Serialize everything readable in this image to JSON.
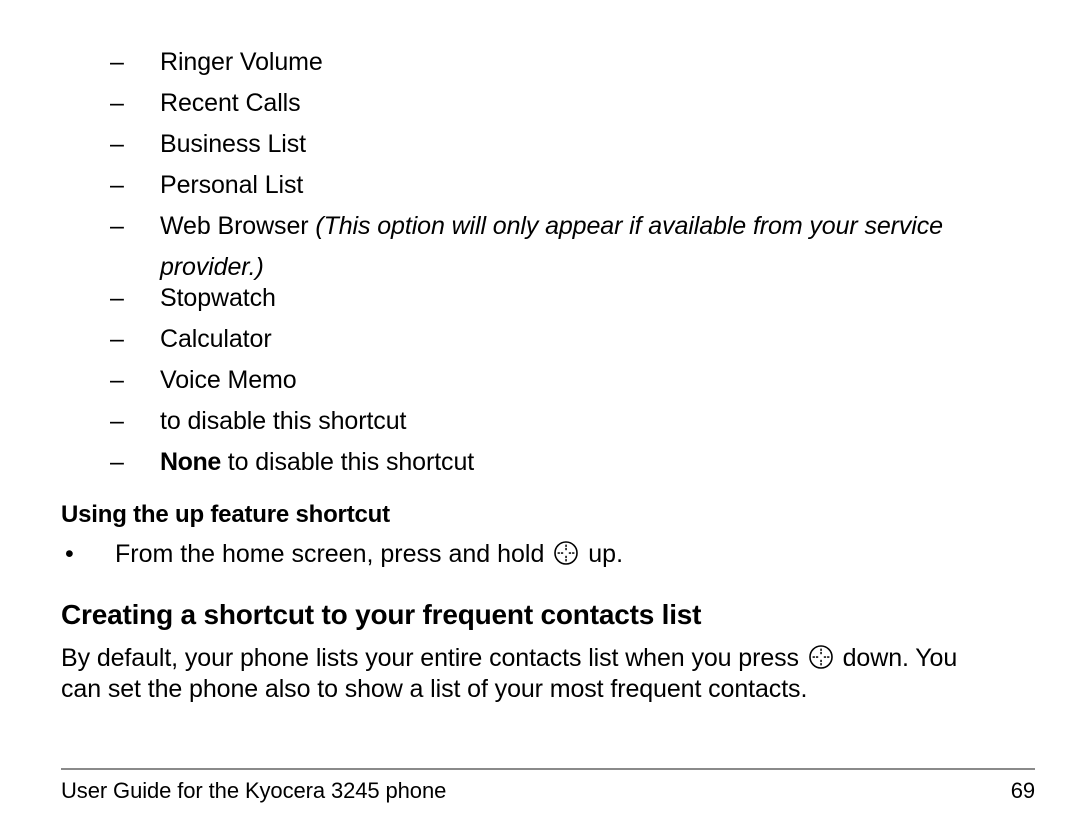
{
  "page": {
    "background": "#ffffff",
    "text_color": "#000000"
  },
  "shortcut_options_list": {
    "marker": "–",
    "items": [
      {
        "text": "Ringer Volume"
      },
      {
        "text": "Recent Calls"
      },
      {
        "text": "Business List"
      },
      {
        "text": "Personal List"
      },
      {
        "text": "Web Browser ",
        "italic_text": "(This option will only appear if available from your service provider.)"
      },
      {
        "text": "Stopwatch"
      },
      {
        "text": "Calculator"
      },
      {
        "text": "Voice Memo"
      },
      {
        "bold_text": "None",
        "text": " to disable this shortcut"
      }
    ]
  },
  "sub_heading": {
    "text": "Using the up feature shortcut"
  },
  "up_shortcut_bullet": {
    "marker": "•",
    "text_before_icon": "From the home screen, press and hold ",
    "icon": "navigation-key-icon",
    "text_after_icon": " up."
  },
  "main_heading": {
    "text": "Creating a shortcut to your frequent contacts list"
  },
  "body_paragraph": {
    "text_before_icon": "By default, your phone lists your entire contacts list when you press ",
    "icon": "navigation-key-icon",
    "text_after_icon": " down. You can set the phone also to show a list of your most frequent contacts."
  },
  "footer": {
    "left_text": "User Guide for the Kyocera 3245 phone",
    "page_number": "69",
    "rule_color": "#8a8a8a"
  }
}
